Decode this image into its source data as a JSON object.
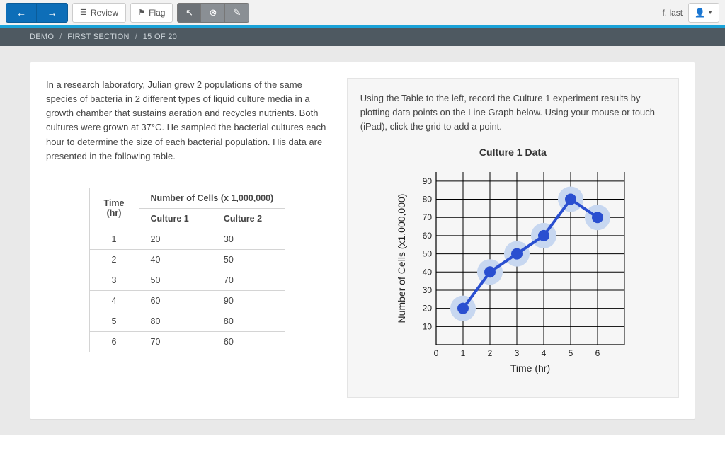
{
  "toolbar": {
    "review_label": "Review",
    "flag_label": "Flag"
  },
  "user": {
    "name": "f. last"
  },
  "breadcrumb": {
    "demo": "DEMO",
    "section": "FIRST SECTION",
    "progress": "15 OF 20"
  },
  "passage": "In a research laboratory, Julian grew 2 populations of the same species of bacteria in 2 different types of liquid culture media in a growth chamber that sustains aeration and recycles nutrients. Both cultures were grown at 37°C. He sampled the bacterial cultures each hour to determine the size of each bacterial population. His data are presented in the following table.",
  "instructions": "Using the Table to the left, record the Culture 1 experiment results by plotting data points on the Line Graph below. Using your mouse or touch (iPad), click the grid to add a point.",
  "table": {
    "time_header": "Time (hr)",
    "cells_header": "Number of Cells (x 1,000,000)",
    "col1_header": "Culture 1",
    "col2_header": "Culture 2",
    "rows": [
      {
        "t": "1",
        "c1": "20",
        "c2": "30"
      },
      {
        "t": "2",
        "c1": "40",
        "c2": "50"
      },
      {
        "t": "3",
        "c1": "50",
        "c2": "70"
      },
      {
        "t": "4",
        "c1": "60",
        "c2": "90"
      },
      {
        "t": "5",
        "c1": "80",
        "c2": "80"
      },
      {
        "t": "6",
        "c1": "70",
        "c2": "60"
      }
    ]
  },
  "chart_data": {
    "type": "line",
    "title": "Culture 1 Data",
    "xlabel": "Time (hr)",
    "ylabel": "Number of Cells (x1,000,000)",
    "xlim": [
      0,
      7
    ],
    "ylim": [
      0,
      95
    ],
    "x_ticks": [
      0,
      1,
      2,
      3,
      4,
      5,
      6
    ],
    "y_ticks": [
      10,
      20,
      30,
      40,
      50,
      60,
      70,
      80,
      90
    ],
    "series": [
      {
        "name": "Culture 1",
        "x": [
          1,
          2,
          3,
          4,
          5,
          6
        ],
        "y": [
          20,
          40,
          50,
          60,
          80,
          70
        ]
      }
    ]
  }
}
